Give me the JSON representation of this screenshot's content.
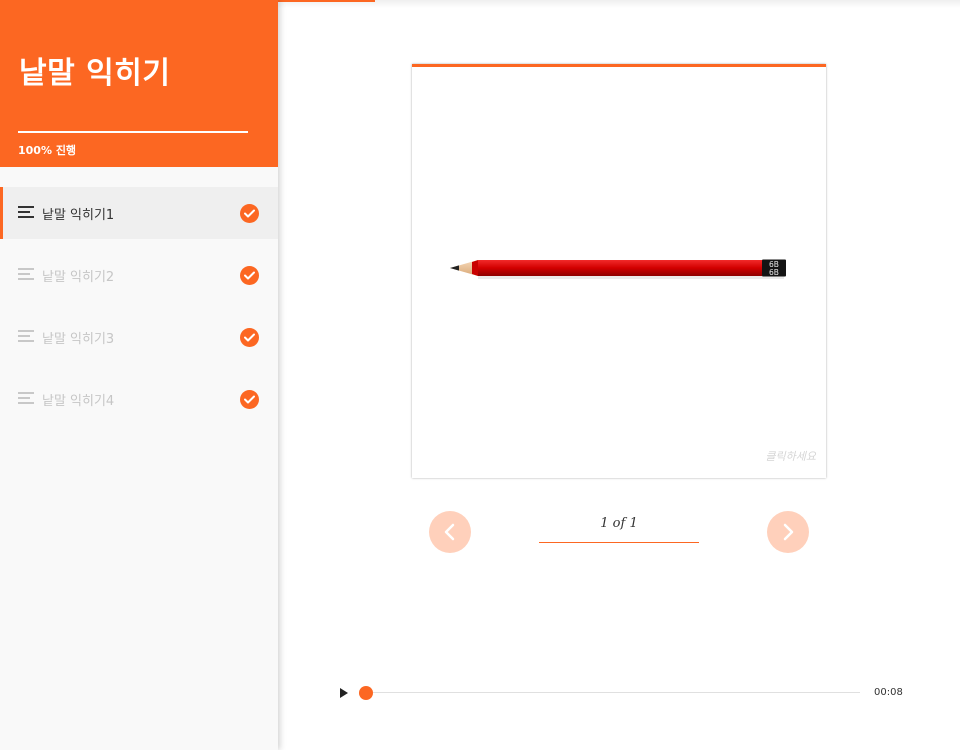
{
  "course": {
    "title": "낱말 익히기",
    "progress_label": "100% 진행",
    "progress_fraction": 1.0
  },
  "lessons": [
    {
      "label": "낱말 익히기1",
      "active": true,
      "completed": true
    },
    {
      "label": "낱말 익히기2",
      "active": false,
      "completed": true
    },
    {
      "label": "낱말 익히기3",
      "active": false,
      "completed": true
    },
    {
      "label": "낱말 익히기4",
      "active": false,
      "completed": true
    }
  ],
  "card": {
    "image": "pencil-image",
    "pencil_grade": [
      "6B",
      "6B"
    ],
    "hint": "클릭하세요"
  },
  "pager": {
    "counter": "1 of 1"
  },
  "audio": {
    "time": "00:08",
    "progress_fraction": 0.0
  },
  "colors": {
    "accent": "#fc6722",
    "accent_light": "#ffd0bb",
    "sidebar_bg": "#f9f9f9"
  }
}
